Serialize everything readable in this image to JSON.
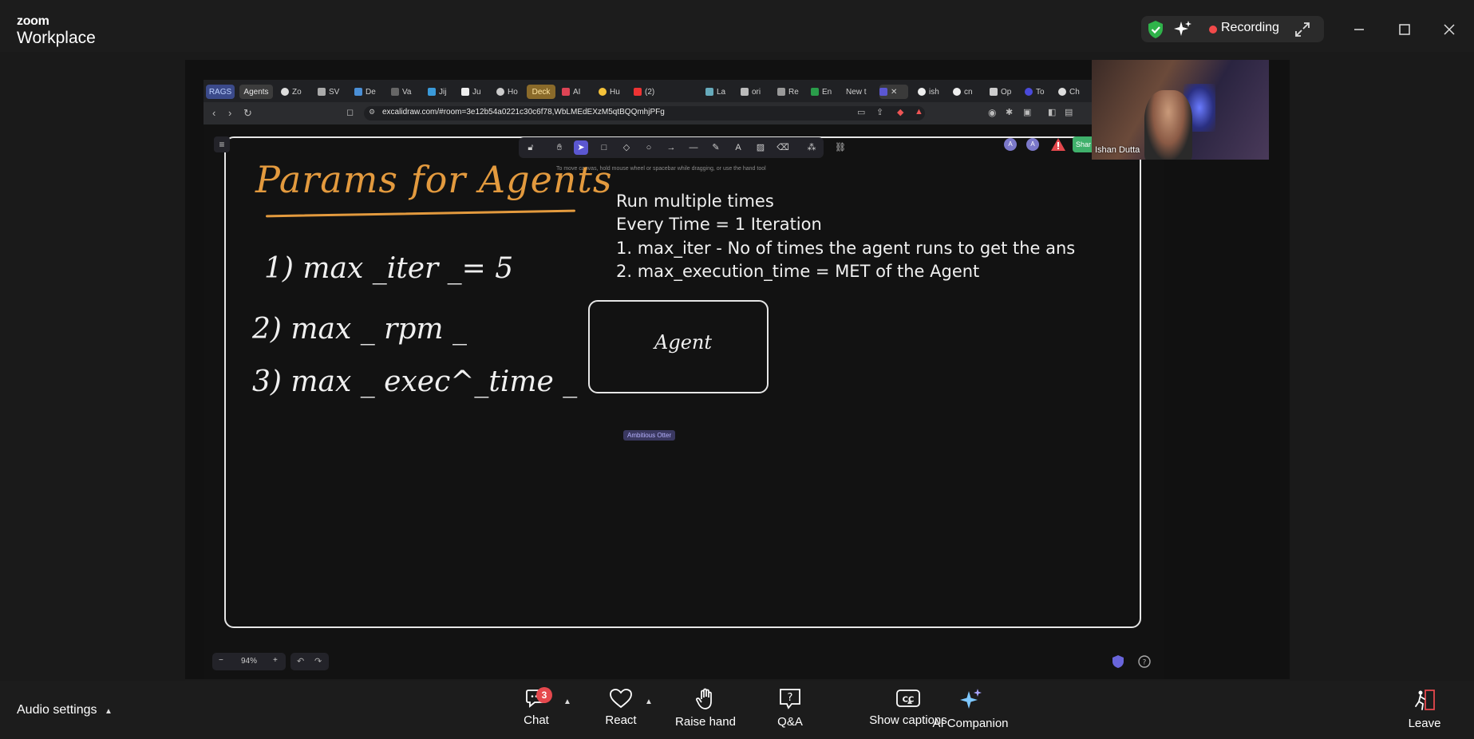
{
  "app": {
    "brand_small": "zoom",
    "brand_big": "Workplace",
    "recording_label": "Recording"
  },
  "browser": {
    "tab_groups": [
      "RAGS",
      "Agents",
      "Deck"
    ],
    "tabs": [
      "Zo",
      "SV",
      "De",
      "Va",
      "Jij",
      "Ju",
      "Ho",
      "AI",
      "Hu",
      "(2)",
      "La",
      "ori",
      "Re",
      "En",
      "New t",
      "ish",
      "cn",
      "Op",
      "To",
      "Ch"
    ],
    "url": "excalidraw.com/#room=3e12b54a0221c30c6f78,WbLMEdEXzM5qtBQQmhjPFg"
  },
  "excalidraw": {
    "hint": "To move canvas, hold mouse wheel or spacebar while dragging, or use the hand tool",
    "avatars": [
      "A",
      "A"
    ],
    "share_label": "Shar",
    "zoom_level": "94%",
    "collaborator_tag": "Ambitious Otter"
  },
  "board": {
    "title": "Params for Agents",
    "params": [
      "1) max _iter _= 5",
      "2) max _ rpm _",
      "3) max _ exec^_time _"
    ],
    "typed_lines": [
      "Run multiple times",
      "Every Time = 1 Iteration",
      "1. max_iter - No of times the agent runs to get the ans",
      "2. max_execution_time = MET of the Agent"
    ],
    "agent_box": "Agent"
  },
  "video": {
    "participant_name": "Ishan Dutta"
  },
  "controls": {
    "audio_settings": "Audio settings",
    "chat": "Chat",
    "chat_badge": "3",
    "react": "React",
    "raise_hand": "Raise hand",
    "qa": "Q&A",
    "captions": "Show captions",
    "ai_companion": "AI Companion",
    "leave": "Leave"
  },
  "colors": {
    "recording": "#f24a4a",
    "title_ink": "#e39a3e",
    "excalidraw_accent": "#5b57d1",
    "badge": "#e5484d"
  }
}
